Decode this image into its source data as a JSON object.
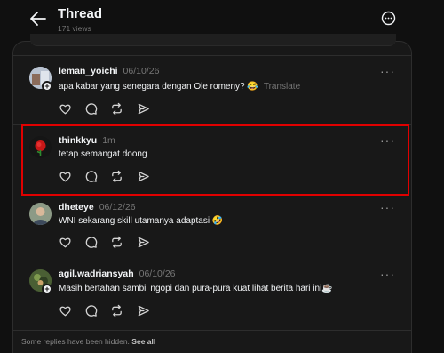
{
  "header": {
    "title": "Thread",
    "views": "171 views"
  },
  "posts": [
    {
      "username": "leman_yoichi",
      "time": "06/10/26",
      "text": "apa kabar yang senegara dengan Ole romeny? 😂",
      "translate": "Translate",
      "more": "···"
    },
    {
      "username": "thinkkyu",
      "time": "1m",
      "text": "tetap semangat doong",
      "more": "···"
    },
    {
      "username": "dheteye",
      "time": "06/12/26",
      "text": "WNI sekarang skill utamanya adaptasi 🤣",
      "more": "···"
    },
    {
      "username": "agil.wadriansyah",
      "time": "06/10/26",
      "text": "Masih bertahan sambil ngopi dan pura-pura kuat lihat berita hari ini☕",
      "more": "···"
    }
  ],
  "footer": {
    "text": "Some replies have been hidden.",
    "link": "See all"
  },
  "colors": {
    "background": "#101010",
    "panel": "#181818",
    "highlight": "#e00000"
  }
}
